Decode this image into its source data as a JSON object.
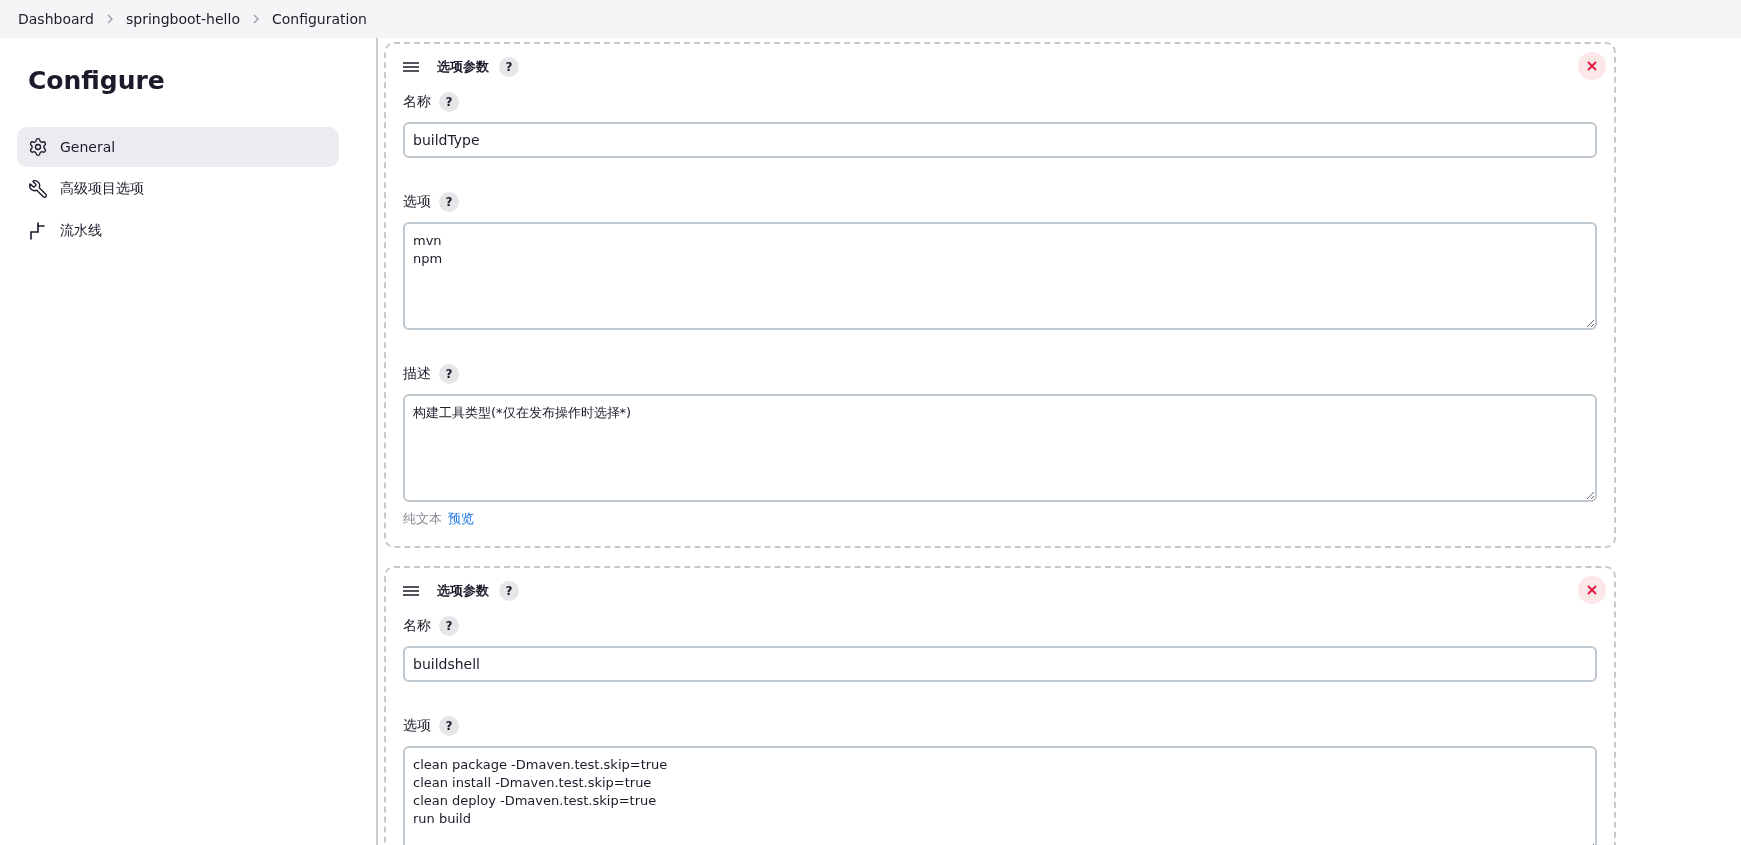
{
  "breadcrumb": [
    {
      "label": "Dashboard"
    },
    {
      "label": "springboot-hello"
    },
    {
      "label": "Configuration"
    }
  ],
  "sidebar": {
    "title": "Configure",
    "items": [
      {
        "label": "General",
        "kind": "gear",
        "selected": true
      },
      {
        "label": "高级项目选项",
        "kind": "wrench",
        "selected": false
      },
      {
        "label": "流水线",
        "kind": "pipeline",
        "selected": false
      }
    ]
  },
  "parameters": [
    {
      "title": "选项参数",
      "help": "?",
      "fields": [
        {
          "kind": "input",
          "label": "名称",
          "help": "?",
          "value": "buildType"
        },
        {
          "kind": "textarea",
          "label": "选项",
          "help": "?",
          "value": "mvn\nnpm"
        },
        {
          "kind": "textarea",
          "label": "描述",
          "help": "?",
          "value": "构建工具类型(*仅在发布操作时选择*)",
          "format": {
            "plain": "纯文本",
            "preview": "预览"
          }
        }
      ]
    },
    {
      "title": "选项参数",
      "help": "?",
      "fields": [
        {
          "kind": "input",
          "label": "名称",
          "help": "?",
          "value": "buildshell"
        },
        {
          "kind": "textarea",
          "label": "选项",
          "help": "?",
          "value": "clean package -Dmaven.test.skip=true\nclean install -Dmaven.test.skip=true\nclean deploy -Dmaven.test.skip=true\nrun build"
        }
      ]
    }
  ]
}
